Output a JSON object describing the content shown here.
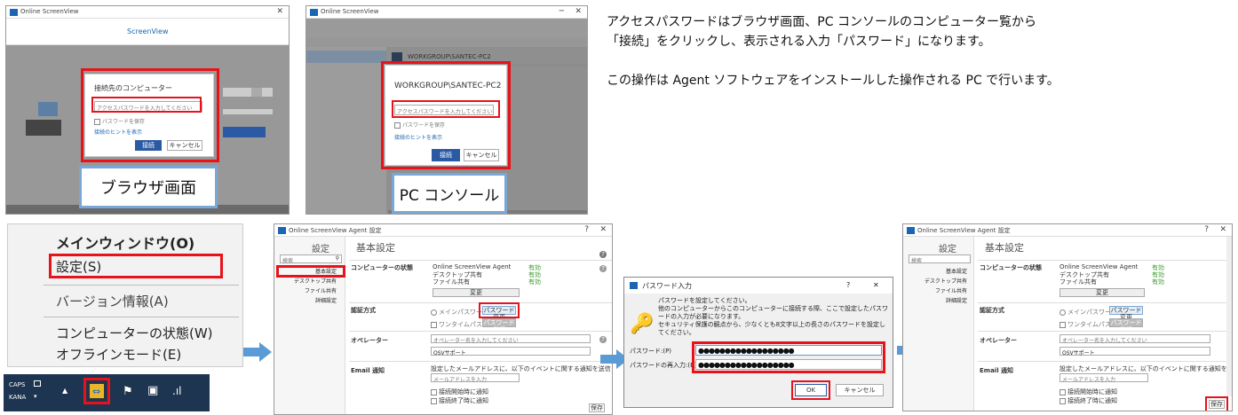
{
  "description": {
    "line1": "アクセスパスワードはブラウザ画面、PC コンソールのコンピューター覧から",
    "line2": "「接続」をクリックし、表示される入力「パスワード」になります。",
    "line3": "この操作は Agent ソフトウェアをインストールした操作される PC で行います。"
  },
  "browser": {
    "tab_title": "Online ScreenView",
    "logo": "ScreenView",
    "dialog_title": "接続先のコンピューター",
    "password_placeholder": "アクセスパスワードを入力してください",
    "remember": "パスワードを保存",
    "help_link": "接続のヒントを表示",
    "connect_btn": "接続",
    "cancel_btn": "キャンセル",
    "caption": "ブラウザ画面"
  },
  "console": {
    "tab_title": "Online ScreenView",
    "computer": "WORKGROUP\\SANTEC-PC2",
    "dialog_title": "WORKGROUP\\SANTEC-PC2",
    "password_placeholder": "アクセスパスワードを入力してください",
    "remember": "パスワードを保存",
    "help_link": "接続のヒントを表示",
    "connect_btn": "接続",
    "cancel_btn": "キャンセル",
    "caption": "PC コンソール"
  },
  "context_menu": {
    "items": [
      "メインウィンドウ(O)",
      "設定(S)",
      "バージョン情報(A)",
      "コンピューターの状態(W)",
      "オフラインモード(E)"
    ],
    "taskbar": {
      "caps": "CAPS",
      "kana": "KANA"
    }
  },
  "settings": {
    "window_title": "Online ScreenView Agent 設定",
    "settings_label": "設定",
    "search": "検索",
    "header": "基本設定",
    "nav": [
      "基本設定",
      "デスクトップ共有",
      "ファイル共有",
      "詳細設定"
    ],
    "status_label": "コンピューターの状態",
    "status_items": [
      "Online ScreenView Agent",
      "デスクトップ共有",
      "ファイル共有"
    ],
    "status_values": [
      "有効",
      "有効",
      "有効"
    ],
    "change_btn": "変更",
    "auth_label": "認証方式",
    "auth_opt1": "メインパスワード",
    "auth_btn": "パスワード変更",
    "auth_opt2": "ワンタイムパスワード",
    "auth_btn2": "パスワード発行",
    "operator_label": "オペレーター",
    "operator_placeholder": "オペレーター名を入力してください",
    "operator_value": "OSVサポート",
    "email_label": "Email 通知",
    "email_desc": "設定したメールアドレスに、以下のイベントに関する通知を送信します。",
    "email_placeholder": "メールアドレスを入力",
    "email_opt1": "接続開始時に通知",
    "email_opt2": "接続終了時に通知",
    "save_btn": "保存"
  },
  "pwdialog": {
    "title": "パスワード入力",
    "msg1": "パスワードを設定してください。",
    "msg2": "他のコンピューターからこのコンピューターに接続する際、ここで設定したパスワードの入力が必要になります。",
    "msg3": "セキュリティ保護の観点から、少なくとも8文字以上の長さのパスワードを設定してください。",
    "pw_label": "パスワード:(P)",
    "pw_confirm_label": "パスワードの再入力:(B)",
    "pw_value": "●●●●●●●●●●●●●●●●●●",
    "ok": "OK",
    "cancel": "キャンセル"
  },
  "colors": {
    "accent_red": "#e8121a",
    "blue_border": "#7aa7d6",
    "arrow": "#5b9bd5",
    "primary": "#2b5aa4"
  }
}
